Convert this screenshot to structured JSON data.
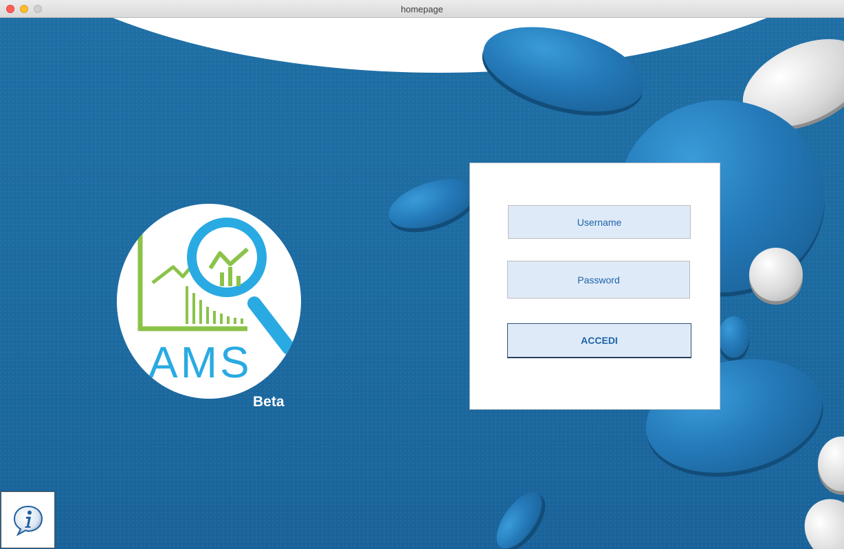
{
  "window": {
    "title": "homepage"
  },
  "logo": {
    "name": "AMS",
    "tag": "Beta"
  },
  "login": {
    "username_placeholder": "Username",
    "password_placeholder": "Password",
    "submit_label": "ACCEDI"
  },
  "info": {
    "icon": "info-icon"
  },
  "colors": {
    "background": "#1e6ea4",
    "field_fill": "#dfeaf8",
    "field_text": "#1c63a8",
    "logo_blue": "#2aaae2",
    "logo_green": "#8bc34a"
  }
}
